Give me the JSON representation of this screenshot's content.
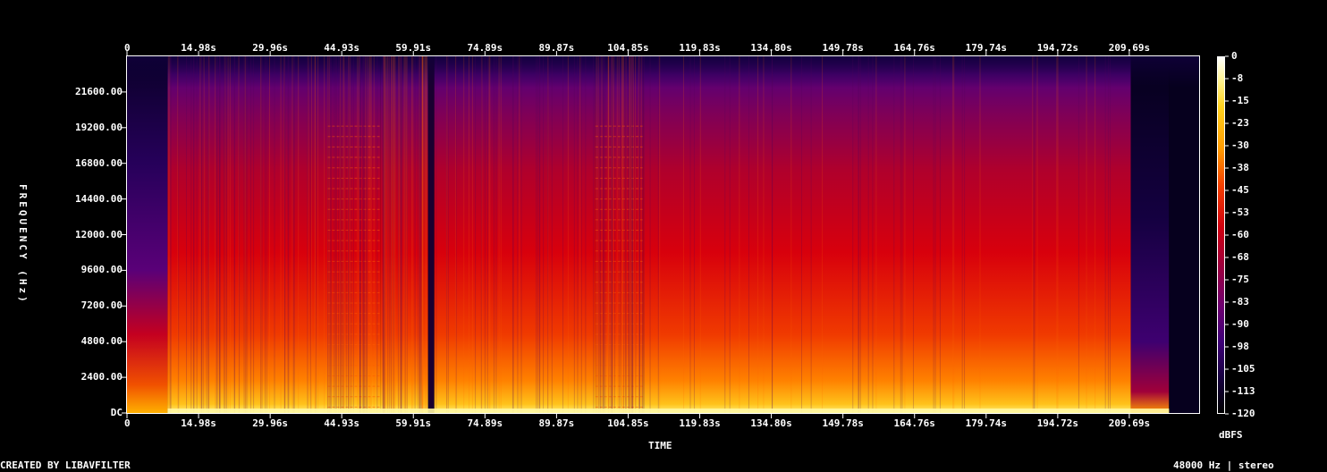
{
  "chart_data": {
    "type": "heatmap",
    "title": "",
    "xlabel": "TIME",
    "ylabel": "FREQUENCY (Hz)",
    "x_ticks": [
      "0",
      "14.98s",
      "29.96s",
      "44.93s",
      "59.91s",
      "74.89s",
      "89.87s",
      "104.85s",
      "119.83s",
      "134.80s",
      "149.78s",
      "164.76s",
      "179.74s",
      "194.72s",
      "209.69s"
    ],
    "x_tick_values": [
      0,
      14.98,
      29.96,
      44.93,
      59.91,
      74.89,
      89.87,
      104.85,
      119.83,
      134.8,
      149.78,
      164.76,
      179.74,
      194.72,
      209.69
    ],
    "xlim": [
      0,
      224.3
    ],
    "y_ticks": [
      "DC",
      "2400.00",
      "4800.00",
      "7200.00",
      "9600.00",
      "12000.00",
      "14400.00",
      "16800.00",
      "19200.00",
      "21600.00"
    ],
    "y_tick_values": [
      0,
      2400,
      4800,
      7200,
      9600,
      12000,
      14400,
      16800,
      19200,
      21600
    ],
    "ylim": [
      0,
      24000
    ],
    "colorbar": {
      "label": "dBFS",
      "ticks": [
        "0",
        "-8",
        "-15",
        "-23",
        "-30",
        "-38",
        "-45",
        "-53",
        "-60",
        "-68",
        "-75",
        "-83",
        "-90",
        "-98",
        "-105",
        "-113",
        "-120"
      ],
      "range": [
        -120,
        0
      ]
    },
    "segments": [
      {
        "t_start": 0,
        "t_end": 8.5,
        "level": "quiet intro"
      },
      {
        "t_start": 8.5,
        "t_end": 42,
        "level": "loud"
      },
      {
        "t_start": 42,
        "t_end": 53,
        "level": "loud, harmonic bands"
      },
      {
        "t_start": 53,
        "t_end": 63,
        "level": "loud"
      },
      {
        "t_start": 63,
        "t_end": 64.3,
        "level": "drop"
      },
      {
        "t_start": 64.3,
        "t_end": 98,
        "level": "loud"
      },
      {
        "t_start": 98,
        "t_end": 108,
        "level": "loud, harmonic bands"
      },
      {
        "t_start": 108,
        "t_end": 210,
        "level": "loud"
      },
      {
        "t_start": 210,
        "t_end": 218,
        "level": "fade out"
      },
      {
        "t_start": 218,
        "t_end": 224.3,
        "level": "silence"
      }
    ],
    "grid": false
  },
  "footer": {
    "left": "CREATED BY LIBAVFILTER",
    "right": "48000 Hz | stereo"
  },
  "colors": {
    "background": "#000000",
    "text": "#ffffff",
    "axis": "#ffffff"
  }
}
